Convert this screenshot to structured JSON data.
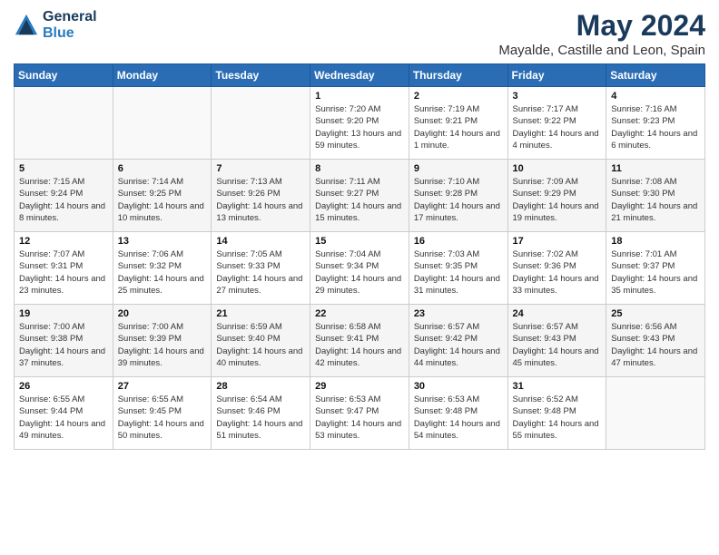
{
  "logo": {
    "line1": "General",
    "line2": "Blue"
  },
  "title": "May 2024",
  "subtitle": "Mayalde, Castille and Leon, Spain",
  "days_of_week": [
    "Sunday",
    "Monday",
    "Tuesday",
    "Wednesday",
    "Thursday",
    "Friday",
    "Saturday"
  ],
  "weeks": [
    [
      {
        "day": "",
        "info": ""
      },
      {
        "day": "",
        "info": ""
      },
      {
        "day": "",
        "info": ""
      },
      {
        "day": "1",
        "info": "Sunrise: 7:20 AM\nSunset: 9:20 PM\nDaylight: 13 hours and 59 minutes."
      },
      {
        "day": "2",
        "info": "Sunrise: 7:19 AM\nSunset: 9:21 PM\nDaylight: 14 hours and 1 minute."
      },
      {
        "day": "3",
        "info": "Sunrise: 7:17 AM\nSunset: 9:22 PM\nDaylight: 14 hours and 4 minutes."
      },
      {
        "day": "4",
        "info": "Sunrise: 7:16 AM\nSunset: 9:23 PM\nDaylight: 14 hours and 6 minutes."
      }
    ],
    [
      {
        "day": "5",
        "info": "Sunrise: 7:15 AM\nSunset: 9:24 PM\nDaylight: 14 hours and 8 minutes."
      },
      {
        "day": "6",
        "info": "Sunrise: 7:14 AM\nSunset: 9:25 PM\nDaylight: 14 hours and 10 minutes."
      },
      {
        "day": "7",
        "info": "Sunrise: 7:13 AM\nSunset: 9:26 PM\nDaylight: 14 hours and 13 minutes."
      },
      {
        "day": "8",
        "info": "Sunrise: 7:11 AM\nSunset: 9:27 PM\nDaylight: 14 hours and 15 minutes."
      },
      {
        "day": "9",
        "info": "Sunrise: 7:10 AM\nSunset: 9:28 PM\nDaylight: 14 hours and 17 minutes."
      },
      {
        "day": "10",
        "info": "Sunrise: 7:09 AM\nSunset: 9:29 PM\nDaylight: 14 hours and 19 minutes."
      },
      {
        "day": "11",
        "info": "Sunrise: 7:08 AM\nSunset: 9:30 PM\nDaylight: 14 hours and 21 minutes."
      }
    ],
    [
      {
        "day": "12",
        "info": "Sunrise: 7:07 AM\nSunset: 9:31 PM\nDaylight: 14 hours and 23 minutes."
      },
      {
        "day": "13",
        "info": "Sunrise: 7:06 AM\nSunset: 9:32 PM\nDaylight: 14 hours and 25 minutes."
      },
      {
        "day": "14",
        "info": "Sunrise: 7:05 AM\nSunset: 9:33 PM\nDaylight: 14 hours and 27 minutes."
      },
      {
        "day": "15",
        "info": "Sunrise: 7:04 AM\nSunset: 9:34 PM\nDaylight: 14 hours and 29 minutes."
      },
      {
        "day": "16",
        "info": "Sunrise: 7:03 AM\nSunset: 9:35 PM\nDaylight: 14 hours and 31 minutes."
      },
      {
        "day": "17",
        "info": "Sunrise: 7:02 AM\nSunset: 9:36 PM\nDaylight: 14 hours and 33 minutes."
      },
      {
        "day": "18",
        "info": "Sunrise: 7:01 AM\nSunset: 9:37 PM\nDaylight: 14 hours and 35 minutes."
      }
    ],
    [
      {
        "day": "19",
        "info": "Sunrise: 7:00 AM\nSunset: 9:38 PM\nDaylight: 14 hours and 37 minutes."
      },
      {
        "day": "20",
        "info": "Sunrise: 7:00 AM\nSunset: 9:39 PM\nDaylight: 14 hours and 39 minutes."
      },
      {
        "day": "21",
        "info": "Sunrise: 6:59 AM\nSunset: 9:40 PM\nDaylight: 14 hours and 40 minutes."
      },
      {
        "day": "22",
        "info": "Sunrise: 6:58 AM\nSunset: 9:41 PM\nDaylight: 14 hours and 42 minutes."
      },
      {
        "day": "23",
        "info": "Sunrise: 6:57 AM\nSunset: 9:42 PM\nDaylight: 14 hours and 44 minutes."
      },
      {
        "day": "24",
        "info": "Sunrise: 6:57 AM\nSunset: 9:43 PM\nDaylight: 14 hours and 45 minutes."
      },
      {
        "day": "25",
        "info": "Sunrise: 6:56 AM\nSunset: 9:43 PM\nDaylight: 14 hours and 47 minutes."
      }
    ],
    [
      {
        "day": "26",
        "info": "Sunrise: 6:55 AM\nSunset: 9:44 PM\nDaylight: 14 hours and 49 minutes."
      },
      {
        "day": "27",
        "info": "Sunrise: 6:55 AM\nSunset: 9:45 PM\nDaylight: 14 hours and 50 minutes."
      },
      {
        "day": "28",
        "info": "Sunrise: 6:54 AM\nSunset: 9:46 PM\nDaylight: 14 hours and 51 minutes."
      },
      {
        "day": "29",
        "info": "Sunrise: 6:53 AM\nSunset: 9:47 PM\nDaylight: 14 hours and 53 minutes."
      },
      {
        "day": "30",
        "info": "Sunrise: 6:53 AM\nSunset: 9:48 PM\nDaylight: 14 hours and 54 minutes."
      },
      {
        "day": "31",
        "info": "Sunrise: 6:52 AM\nSunset: 9:48 PM\nDaylight: 14 hours and 55 minutes."
      },
      {
        "day": "",
        "info": ""
      }
    ]
  ]
}
